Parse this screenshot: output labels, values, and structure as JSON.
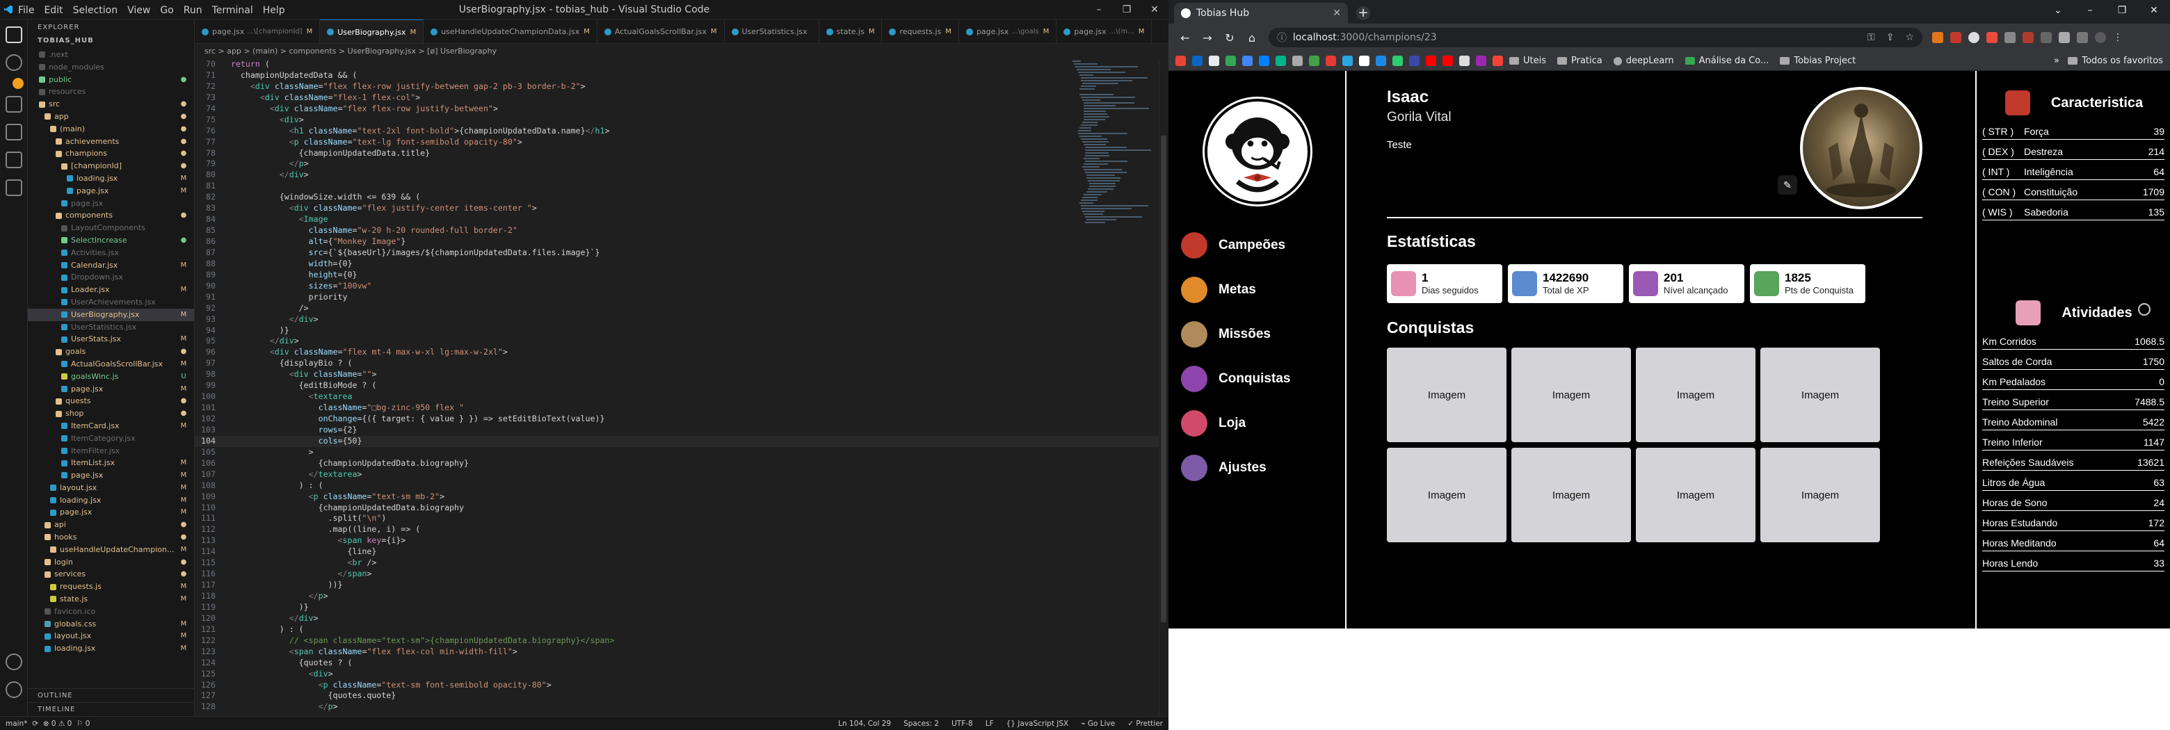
{
  "vscode": {
    "window_title": "UserBiography.jsx - tobias_hub - Visual Studio Code",
    "menu": [
      "File",
      "Edit",
      "Selection",
      "View",
      "Go",
      "Run",
      "Terminal",
      "Help"
    ],
    "explorer_header": "EXPLORER",
    "project_header": "TOBIAS_HUB",
    "tree": [
      {
        "name": ".next",
        "indent": 1,
        "kind": "dim",
        "status": ""
      },
      {
        "name": "node_modules",
        "indent": 1,
        "kind": "dim",
        "status": ""
      },
      {
        "name": "public",
        "indent": 1,
        "kind": "unt",
        "status": "●"
      },
      {
        "name": "resources",
        "indent": 1,
        "kind": "dim",
        "status": ""
      },
      {
        "name": "src",
        "indent": 1,
        "kind": "mod",
        "status": "●"
      },
      {
        "name": "app",
        "indent": 2,
        "kind": "mod",
        "status": "●"
      },
      {
        "name": "(main)",
        "indent": 3,
        "kind": "mod",
        "status": "●"
      },
      {
        "name": "achievements",
        "indent": 4,
        "kind": "mod",
        "status": "●"
      },
      {
        "name": "champions",
        "indent": 4,
        "kind": "mod",
        "status": "●"
      },
      {
        "name": "[championId]",
        "indent": 5,
        "kind": "mod",
        "status": "●"
      },
      {
        "name": "loading.jsx",
        "indent": 6,
        "kind": "mod",
        "status": "M"
      },
      {
        "name": "page.jsx",
        "indent": 6,
        "kind": "mod",
        "status": "M"
      },
      {
        "name": "page.jsx",
        "indent": 5,
        "kind": "dim",
        "status": ""
      },
      {
        "name": "components",
        "indent": 4,
        "kind": "mod",
        "status": "●"
      },
      {
        "name": "LayoutComponents",
        "indent": 5,
        "kind": "dim",
        "status": ""
      },
      {
        "name": "SelectIncrease",
        "indent": 5,
        "kind": "unt",
        "status": "●"
      },
      {
        "name": "Activities.jsx",
        "indent": 5,
        "kind": "dim",
        "status": ""
      },
      {
        "name": "Calendar.jsx",
        "indent": 5,
        "kind": "mod",
        "status": "M"
      },
      {
        "name": "Dropdown.jsx",
        "indent": 5,
        "kind": "dim",
        "status": ""
      },
      {
        "name": "Loader.jsx",
        "indent": 5,
        "kind": "mod",
        "status": "M"
      },
      {
        "name": "UserAchievements.jsx",
        "indent": 5,
        "kind": "dim",
        "status": ""
      },
      {
        "name": "UserBiography.jsx",
        "indent": 5,
        "kind": "mod",
        "status": "M",
        "selected": true
      },
      {
        "name": "UserStatistics.jsx",
        "indent": 5,
        "kind": "dim",
        "status": ""
      },
      {
        "name": "UserStats.jsx",
        "indent": 5,
        "kind": "mod",
        "status": "M"
      },
      {
        "name": "goals",
        "indent": 4,
        "kind": "mod",
        "status": "●"
      },
      {
        "name": "ActualGoalsScrollBar.jsx",
        "indent": 5,
        "kind": "mod",
        "status": "M"
      },
      {
        "name": "goalsWinc.js",
        "indent": 5,
        "kind": "unt",
        "status": "U"
      },
      {
        "name": "page.jsx",
        "indent": 5,
        "kind": "mod",
        "status": "M"
      },
      {
        "name": "quests",
        "indent": 4,
        "kind": "mod",
        "status": "●"
      },
      {
        "name": "shop",
        "indent": 4,
        "kind": "mod",
        "status": "●"
      },
      {
        "name": "ItemCard.jsx",
        "indent": 5,
        "kind": "mod",
        "status": "M"
      },
      {
        "name": "ItemCategory.jsx",
        "indent": 5,
        "kind": "dim",
        "status": ""
      },
      {
        "name": "ItemFilter.jsx",
        "indent": 5,
        "kind": "dim",
        "status": ""
      },
      {
        "name": "ItemList.jsx",
        "indent": 5,
        "kind": "mod",
        "status": "M"
      },
      {
        "name": "page.jsx",
        "indent": 5,
        "kind": "mod",
        "status": "M"
      },
      {
        "name": "layout.jsx",
        "indent": 3,
        "kind": "mod",
        "status": "M"
      },
      {
        "name": "loading.jsx",
        "indent": 3,
        "kind": "mod",
        "status": "M"
      },
      {
        "name": "page.jsx",
        "indent": 3,
        "kind": "mod",
        "status": "M"
      },
      {
        "name": "api",
        "indent": 2,
        "kind": "mod",
        "status": "●"
      },
      {
        "name": "hooks",
        "indent": 2,
        "kind": "mod",
        "status": "●"
      },
      {
        "name": "useHandleUpdateChampion...",
        "indent": 3,
        "kind": "mod",
        "status": "M"
      },
      {
        "name": "login",
        "indent": 2,
        "kind": "mod",
        "status": "●"
      },
      {
        "name": "services",
        "indent": 2,
        "kind": "mod",
        "status": "●"
      },
      {
        "name": "requests.js",
        "indent": 3,
        "kind": "mod",
        "status": "M"
      },
      {
        "name": "state.js",
        "indent": 3,
        "kind": "mod",
        "status": "M"
      },
      {
        "name": "favicon.ico",
        "indent": 2,
        "kind": "dim",
        "status": ""
      },
      {
        "name": "globals.css",
        "indent": 2,
        "kind": "mod",
        "status": "M"
      },
      {
        "name": "layout.jsx",
        "indent": 2,
        "kind": "mod",
        "status": "M"
      },
      {
        "name": "loading.jsx",
        "indent": 2,
        "kind": "mod",
        "status": "M"
      }
    ],
    "outline_label": "OUTLINE",
    "timeline_label": "TIMELINE",
    "tabs": [
      {
        "name": "page.jsx",
        "sub": "...\\[championId]",
        "mark": "M",
        "active": false
      },
      {
        "name": "UserBiography.jsx",
        "sub": "",
        "mark": "M",
        "active": true
      },
      {
        "name": "useHandleUpdateChampionData.jsx",
        "sub": "",
        "mark": "M",
        "active": false
      },
      {
        "name": "ActualGoalsScrollBar.jsx",
        "sub": "",
        "mark": "M",
        "active": false
      },
      {
        "name": "UserStatistics.jsx",
        "sub": "",
        "mark": "",
        "active": false
      },
      {
        "name": "state.js",
        "sub": "",
        "mark": "M",
        "active": false
      },
      {
        "name": "requests.js",
        "sub": "",
        "mark": "M",
        "active": false
      },
      {
        "name": "page.jsx",
        "sub": "...\\goals",
        "mark": "M",
        "active": false
      },
      {
        "name": "page.jsx",
        "sub": "...\\(m...",
        "mark": "M",
        "active": false
      }
    ],
    "breadcrumb": "src > app > (main) > components > UserBiography.jsx > [ø] UserBiography",
    "code_start": 70,
    "current_line": 104,
    "code": [
      "  return (",
      "    championUpdatedData && (",
      "      <div className=\"flex flex-row justify-between gap-2 pb-3 border-b-2\">",
      "        <div className=\"flex-1 flex-col\">",
      "          <div className=\"flex flex-row justify-between\">",
      "            <div>",
      "              <h1 className=\"text-2xl font-bold\">{championUpdatedData.name}</h1>",
      "              <p className=\"text-lg font-semibold opacity-80\">",
      "                {championUpdatedData.title}",
      "              </p>",
      "            </div>",
      "",
      "            {windowSize.width <= 639 && (",
      "              <div className=\"flex justify-center items-center \">",
      "                <Image",
      "                  className=\"w-20 h-20 rounded-full border-2\"",
      "                  alt={\"Monkey Image\"}",
      "                  src={`${baseUrl}/images/${championUpdatedData.files.image}`}",
      "                  width={0}",
      "                  height={0}",
      "                  sizes=\"100vw\"",
      "                  priority",
      "                />",
      "              </div>",
      "            )}",
      "          </div>",
      "          <div className=\"flex mt-4 max-w-xl lg:max-w-2xl\">",
      "            {displayBio ? (",
      "              <div className=\"\">",
      "                {editBioMode ? (",
      "                  <textarea",
      "                    className=\"□bg-zinc-950 flex \"",
      "                    onChange={({ target: { value } }) => setEditBioText(value)}",
      "                    rows={2}",
      "                    cols={50}",
      "                  >",
      "                    {championUpdatedData.biography}",
      "                  </textarea>",
      "                ) : (",
      "                  <p className=\"text-sm mb-2\">",
      "                    {championUpdatedData.biography",
      "                      .split(\"\\n\")",
      "                      .map((line, i) => (",
      "                        <span key={i}>",
      "                          {line}",
      "                          <br />",
      "                        </span>",
      "                      ))}",
      "                  </p>",
      "                )}",
      "              </div>",
      "            ) : (",
      "              // <span className=\"text-sm\">{championUpdatedData.biography}</span>",
      "              <span className=\"flex flex-col min-width-fill\">",
      "                {quotes ? (",
      "                  <div>",
      "                    <p className=\"text-sm font-semibold opacity-80\">",
      "                      {quotes.quote}",
      "                    </p>"
    ],
    "status": {
      "branch": "main*",
      "sync": "⟳",
      "problems": "⊗ 0 ⚠ 0",
      "info": "⚐ 0",
      "position": "Ln 104, Col 29",
      "spaces": "Spaces: 2",
      "encoding": "UTF-8",
      "eol": "LF",
      "language": "{} JavaScript JSX",
      "golive": "⌁ Go Live",
      "prettier": "✓ Prettier"
    }
  },
  "chrome": {
    "tab_title": "Tobias Hub",
    "url_host": "localhost",
    "url_path": ":3000/champions/23",
    "bookmarks": [
      "Uteis",
      "Pratica",
      "deepLearn",
      "Análise da Co...",
      "Tobias Project"
    ],
    "all_bookmarks": "Todos os favoritos"
  },
  "app": {
    "nav": [
      {
        "label": "Campeões",
        "icon": "champions-icon",
        "color": "#c0392b"
      },
      {
        "label": "Metas",
        "icon": "goals-icon",
        "color": "#e08a2a"
      },
      {
        "label": "Missões",
        "icon": "quests-icon",
        "color": "#b08a5a"
      },
      {
        "label": "Conquistas",
        "icon": "achievements-icon",
        "color": "#8e44ad"
      },
      {
        "label": "Loja",
        "icon": "shop-icon",
        "color": "#d24a6a"
      },
      {
        "label": "Ajustes",
        "icon": "settings-icon",
        "color": "#7d5ba6"
      }
    ],
    "profile": {
      "name": "Isaac",
      "title": "Gorila Vital",
      "bio": "Teste"
    },
    "stats_title": "Estatísticas",
    "stats": [
      {
        "value": "1",
        "label": "Dias seguidos",
        "color": "#e891b5"
      },
      {
        "value": "1422690",
        "label": "Total de XP",
        "color": "#5b8bd0"
      },
      {
        "value": "201",
        "label": "Nível alcançado",
        "color": "#9b59b6"
      },
      {
        "value": "1825",
        "label": "Pts de Conquista",
        "color": "#58a55c"
      }
    ],
    "achievements_title": "Conquistas",
    "achievement_label": "Imagem",
    "attributes_title": "Caracteristica",
    "attributes": [
      {
        "abbr": "( STR )",
        "name": "Força",
        "value": "39"
      },
      {
        "abbr": "( DEX )",
        "name": "Destreza",
        "value": "214"
      },
      {
        "abbr": "( INT )",
        "name": "Inteligência",
        "value": "64"
      },
      {
        "abbr": "( CON )",
        "name": "Constituição",
        "value": "1709"
      },
      {
        "abbr": "( WIS )",
        "name": "Sabedoria",
        "value": "135"
      }
    ],
    "activities_title": "Atividades",
    "activities": [
      {
        "name": "Km Corridos",
        "value": "1068.5"
      },
      {
        "name": "Saltos de Corda",
        "value": "1750"
      },
      {
        "name": "Km Pedalados",
        "value": "0"
      },
      {
        "name": "Treino Superior",
        "value": "7488.5"
      },
      {
        "name": "Treino Abdominal",
        "value": "5422"
      },
      {
        "name": "Treino Inferior",
        "value": "1147"
      },
      {
        "name": "Refeições Saudáveis",
        "value": "13621"
      },
      {
        "name": "Litros de Água",
        "value": "63"
      },
      {
        "name": "Horas de Sono",
        "value": "24"
      },
      {
        "name": "Horas Estudando",
        "value": "172"
      },
      {
        "name": "Horas Meditando",
        "value": "64"
      },
      {
        "name": "Horas Lendo",
        "value": "33"
      }
    ]
  }
}
